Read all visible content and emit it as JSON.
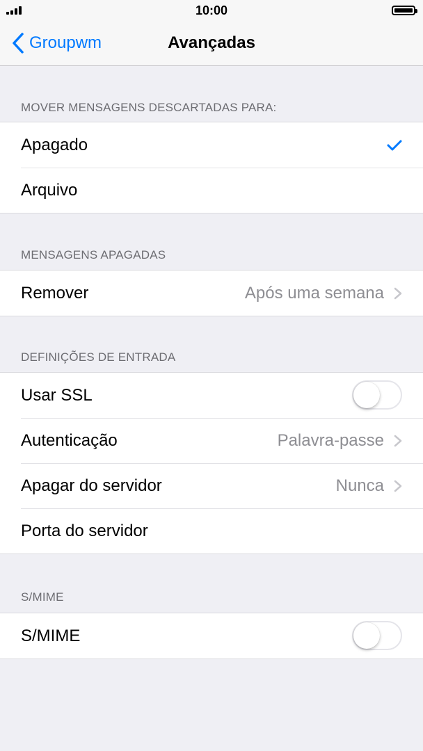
{
  "status_bar": {
    "time": "10:00"
  },
  "nav": {
    "back_label": "Groupwm",
    "title": "Avançadas"
  },
  "sections": [
    {
      "header": "MOVER MENSAGENS DESCARTADAS PARA:",
      "rows": [
        {
          "label": "Apagado",
          "checked": true
        },
        {
          "label": "Arquivo",
          "checked": false
        }
      ]
    },
    {
      "header": "MENSAGENS APAGADAS",
      "rows": [
        {
          "label": "Remover",
          "value": "Após uma semana"
        }
      ]
    },
    {
      "header": "DEFINIÇÕES DE ENTRADA",
      "rows": [
        {
          "label": "Usar SSL",
          "toggle": false
        },
        {
          "label": "Autenticação",
          "value": "Palavra-passe"
        },
        {
          "label": "Apagar do servidor",
          "value": "Nunca"
        },
        {
          "label": "Porta do servidor"
        }
      ]
    },
    {
      "header": "S/MIME",
      "rows": [
        {
          "label": "S/MIME",
          "toggle": false
        }
      ]
    }
  ],
  "colors": {
    "accent": "#007aff",
    "background": "#efeff4",
    "secondary_text": "#8e8e93"
  }
}
